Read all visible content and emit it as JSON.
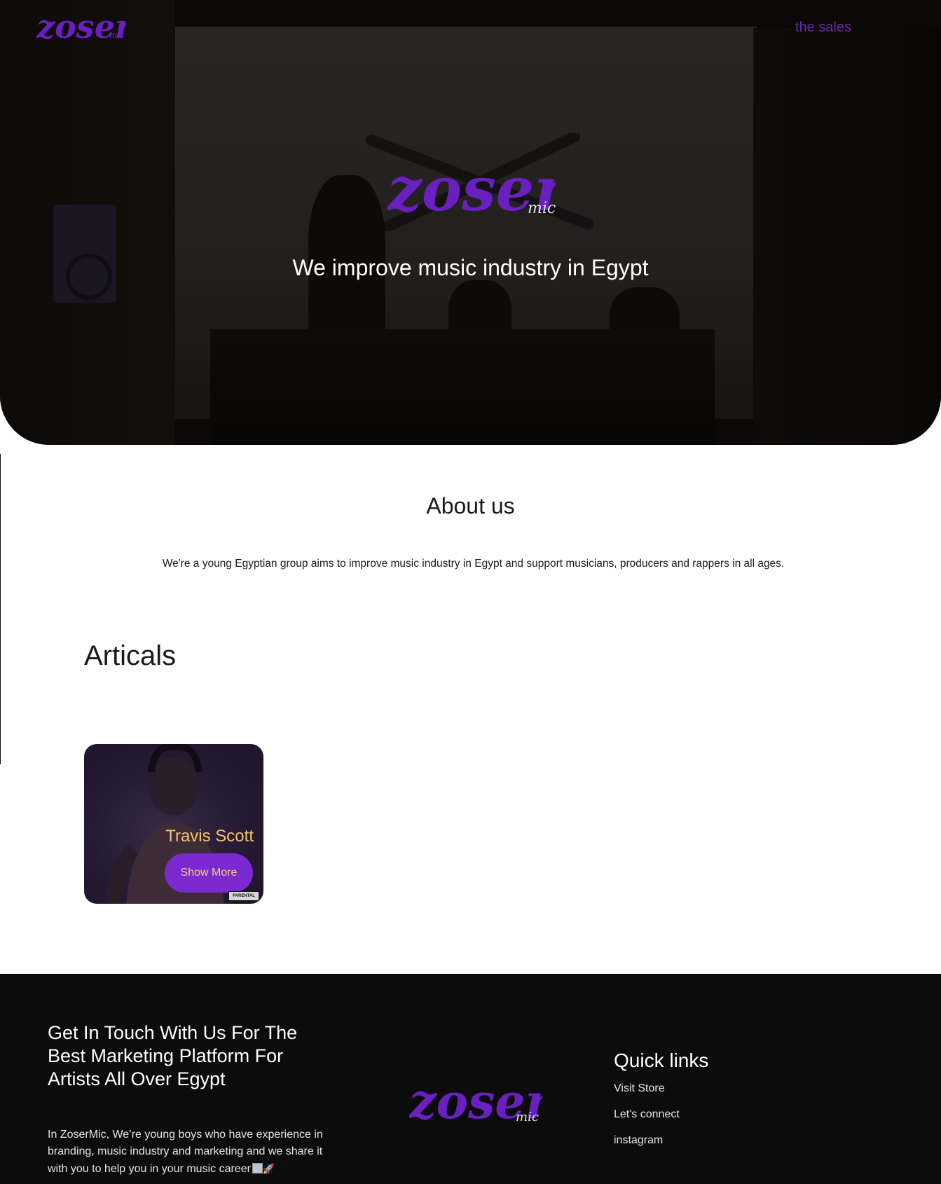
{
  "brand": {
    "logo_main": "zoser",
    "logo_sub": "mic",
    "logo_color": "#6a1fc0"
  },
  "nav": {
    "sales_link": "the sales",
    "link_color": "#6a2aa6"
  },
  "hero": {
    "tagline": "We improve music industry in Egypt"
  },
  "about": {
    "title": "About us",
    "text": "We're a young Egyptian group aims to improve music industry in Egypt and support musicians, producers and rappers in all ages."
  },
  "articles": {
    "title": "Articals",
    "cards": [
      {
        "title": "Travis Scott",
        "button_label": "Show More",
        "advisory": "PARENTAL ADVISORY"
      }
    ]
  },
  "footer": {
    "heading": "Get In Touch With Us For The Best Marketing Platform For Artists All Over Egypt",
    "text": "In ZoserMic, We’re young boys who have experience in branding, music industry and marketing and we share it with you to help you in your music career",
    "emoji_icons": [
      "image-icon",
      "rocket-icon"
    ],
    "quick_links_title": "Quick links",
    "quick_links": [
      "Visit Store",
      "Let's connect",
      "instagram"
    ]
  }
}
